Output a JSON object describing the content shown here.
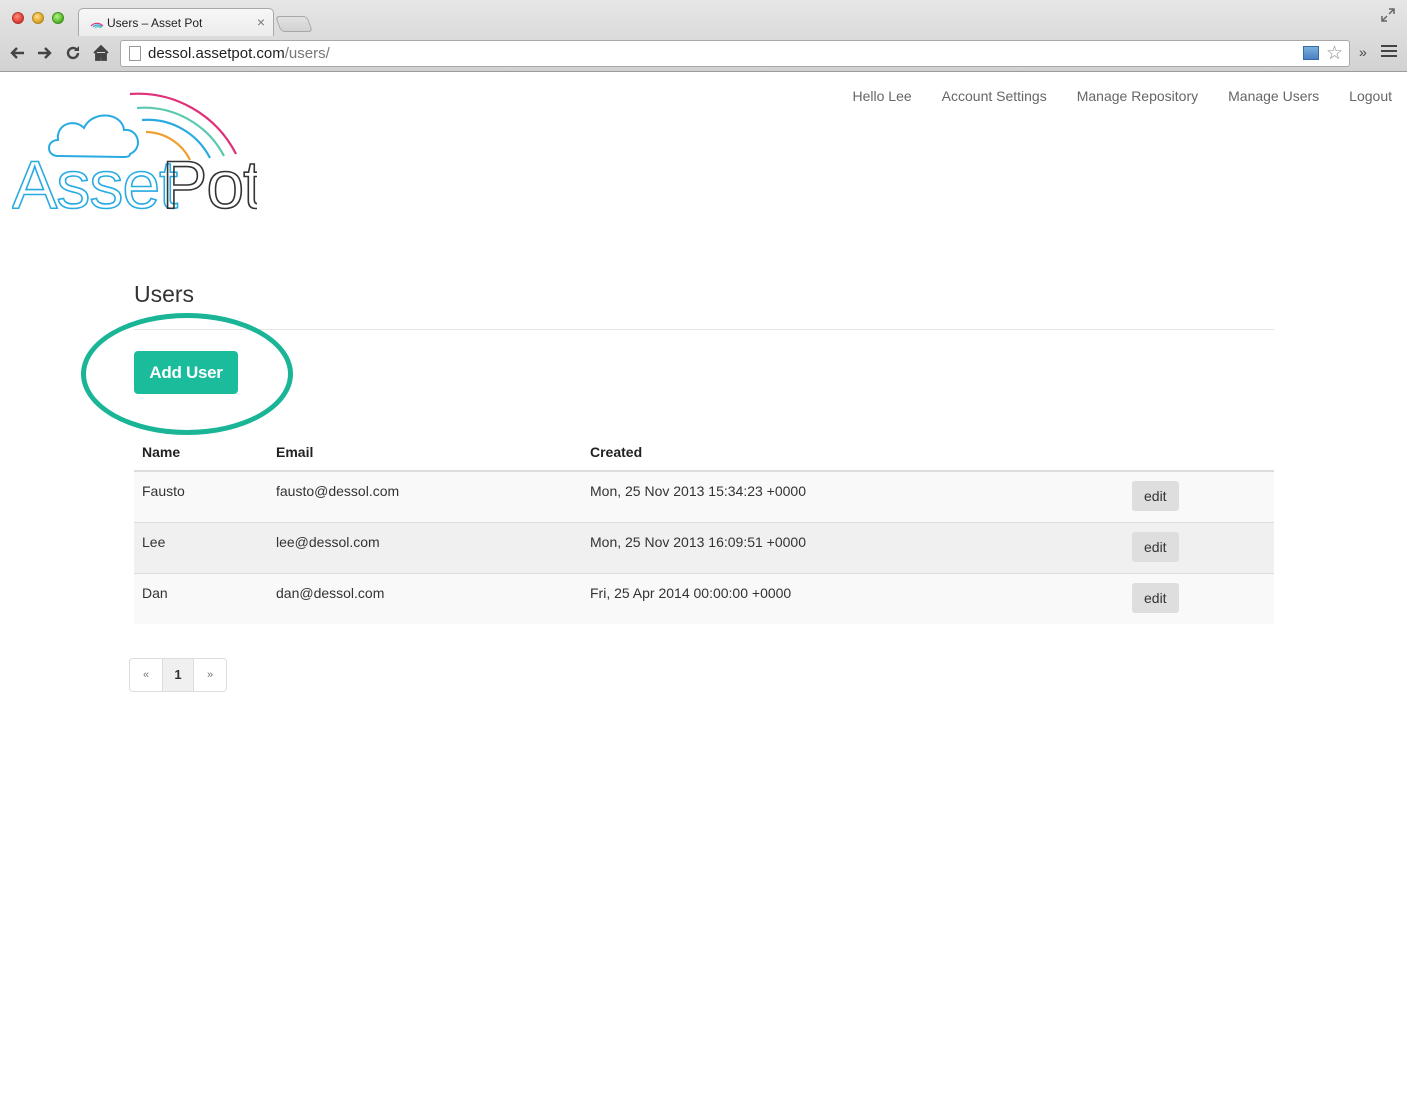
{
  "browser": {
    "tab_title": "Users – Asset Pot",
    "tab_close": "×",
    "url_host": "dessol.assetpot.com",
    "url_path": "/users/",
    "chevron": "»"
  },
  "nav": {
    "items": [
      "Hello Lee",
      "Account Settings",
      "Manage Repository",
      "Manage Users",
      "Logout"
    ]
  },
  "logo": {
    "text_left": "Asset",
    "text_right": "Pot"
  },
  "page": {
    "title": "Users",
    "add_button": "Add User"
  },
  "table": {
    "headers": [
      "Name",
      "Email",
      "Created"
    ],
    "rows": [
      {
        "name": "Fausto",
        "email": "fausto@dessol.com",
        "created": "Mon, 25 Nov 2013 15:34:23 +0000",
        "action": "edit"
      },
      {
        "name": "Lee",
        "email": "lee@dessol.com",
        "created": "Mon, 25 Nov 2013 16:09:51 +0000",
        "action": "edit"
      },
      {
        "name": "Dan",
        "email": "dan@dessol.com",
        "created": "Fri, 25 Apr 2014 00:00:00 +0000",
        "action": "edit"
      }
    ]
  },
  "pagination": {
    "prev": "«",
    "current": "1",
    "next": "»"
  },
  "colors": {
    "accent": "#1abc9c",
    "logo_blue": "#29abe2",
    "logo_pink": "#e0307a",
    "logo_orange": "#f0a030",
    "logo_green": "#5cc8b0"
  }
}
